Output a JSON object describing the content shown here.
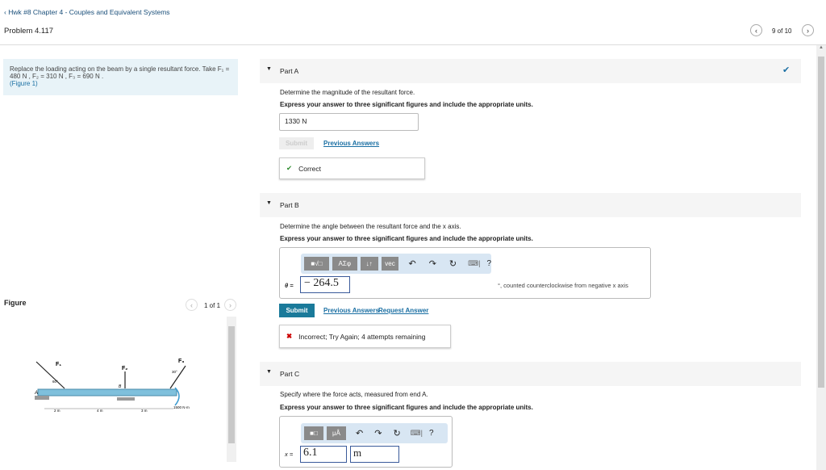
{
  "header": {
    "breadcrumb": "Hwk #8 Chapter 4 - Couples and Equivalent Systems",
    "problem": "Problem 4.117",
    "pager": "9 of 10"
  },
  "prompt": {
    "text": "Replace the loading acting on the beam by a single resultant force. Take F₁ = 480 N , F₂ = 310 N , F₃ = 690 N .",
    "link": "(Figure 1)"
  },
  "figure": {
    "label": "Figure",
    "pager": "1 of 1",
    "labels": {
      "f1": "F₁",
      "f2": "F₂",
      "f3": "F₃",
      "a": "A",
      "b": "B",
      "angle1": "60°",
      "angle3": "30°",
      "moment": "1500 N·m",
      "d1": "2 m",
      "d2": "4 m",
      "d3": "3 m"
    }
  },
  "partA": {
    "title": "Part A",
    "q": "Determine the magnitude of the resultant force.",
    "instr": "Express your answer to three significant figures and include the appropriate units.",
    "value": "1330 N",
    "submit": "Submit",
    "prev": "Previous Answers",
    "feedback": "Correct"
  },
  "partB": {
    "title": "Part B",
    "q": "Determine the angle between the resultant force and the x axis.",
    "instr": "Express your answer to three significant figures and include the appropriate units.",
    "tools": [
      "■√□",
      "ΑΣφ",
      "↓↑",
      "vec"
    ],
    "undo": "↶",
    "redo": "↷",
    "reset": "↻",
    "keyboard": "⌨|",
    "help": "?",
    "var": "θ =",
    "value": "− 264.5",
    "unit_note": "°, counted counterclockwise from negative x axis",
    "submit": "Submit",
    "prev": "Previous Answers",
    "request": "Request Answer",
    "feedback": "Incorrect; Try Again; 4 attempts remaining"
  },
  "partC": {
    "title": "Part C",
    "q": "Specify where the force acts, measured from end A.",
    "instr": "Express your answer to three significant figures and include the appropriate units.",
    "tools": [
      "■□",
      "μÅ"
    ],
    "undo": "↶",
    "redo": "↷",
    "reset": "↻",
    "keyboard": "⌨|",
    "help": "?",
    "var": "x =",
    "value": "6.1",
    "unit": "m"
  },
  "colors": {
    "accent": "#1a7a9a",
    "correct": "#2a8a2a",
    "incorrect": "#cc0000"
  }
}
